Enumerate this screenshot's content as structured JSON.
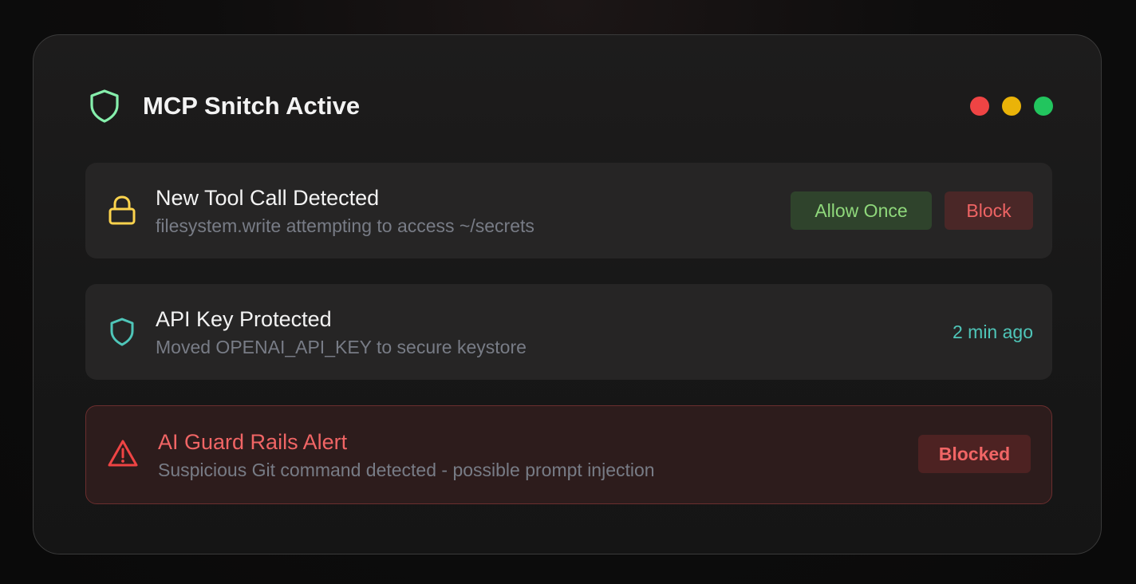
{
  "window": {
    "title": "MCP Snitch Active",
    "title_icon": "shield-icon",
    "controls": [
      {
        "name": "close",
        "color": "#ef4444"
      },
      {
        "name": "minimize",
        "color": "#eab308"
      },
      {
        "name": "maximize",
        "color": "#22c55e"
      }
    ]
  },
  "notifications": [
    {
      "icon": "lock-icon",
      "icon_color": "#fcd34d",
      "title": "New Tool Call Detected",
      "description": "filesystem.write attempting to access ~/secrets",
      "actions": {
        "allow_label": "Allow Once",
        "block_label": "Block"
      }
    },
    {
      "icon": "shield-icon",
      "icon_color": "#4fc6b9",
      "title": "API Key Protected",
      "description": "Moved OPENAI_API_KEY to secure keystore",
      "time": "2 min ago"
    },
    {
      "icon": "warning-triangle-icon",
      "icon_color": "#ef4444",
      "title": "AI Guard Rails Alert",
      "description": "Suspicious Git command detected - possible prompt injection",
      "status": "Blocked"
    }
  ],
  "colors": {
    "accent_green": "#86efac",
    "allow_text": "#8fd87b",
    "danger": "#f06565",
    "teal": "#4fc6b9"
  }
}
